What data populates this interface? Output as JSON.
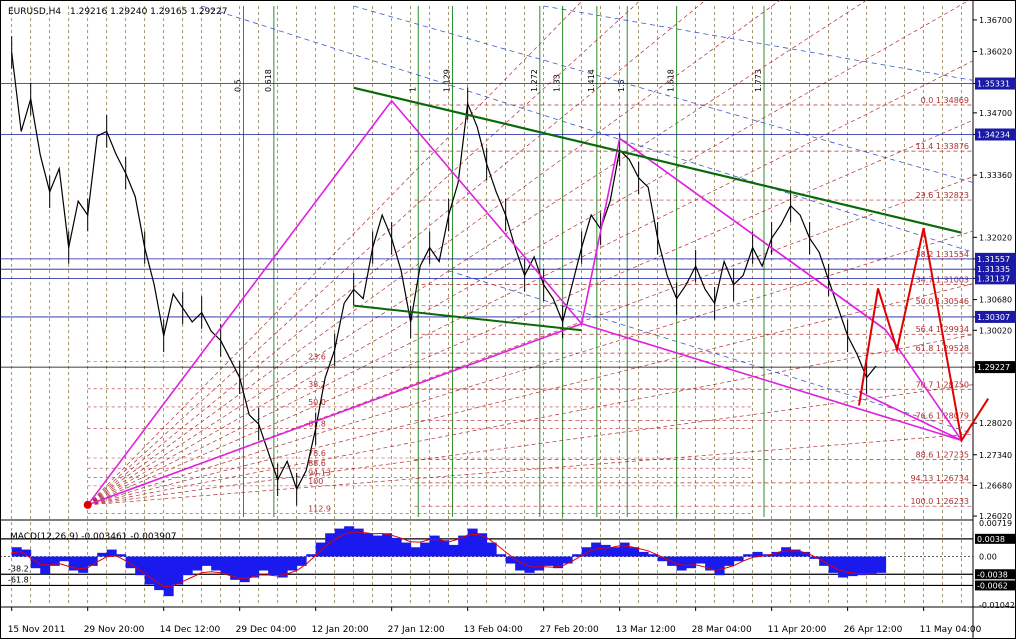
{
  "chart_data": {
    "type": "line",
    "symbol": "EURUSD,H4",
    "ohlc_header": "1.29216 1.29240 1.29165 1.29227",
    "price_axis": {
      "ylim": [
        1.26,
        1.37
      ],
      "ticks": [
        "1.36700",
        "1.36020",
        "1.35331",
        "1.34700",
        "1.34234",
        "1.33360",
        "1.32020",
        "1.31557",
        "1.31335",
        "1.31137",
        "1.30680",
        "1.30307",
        "1.30020",
        "1.29227",
        "1.28020",
        "1.27340",
        "1.26680",
        "1.26020"
      ],
      "highlighted": [
        {
          "label": "1.35331",
          "color": "#1a1aa6"
        },
        {
          "label": "1.34234",
          "color": "#1a1aa6"
        },
        {
          "label": "1.31557",
          "color": "#1a1aa6"
        },
        {
          "label": "1.31335",
          "color": "#1a1aa6"
        },
        {
          "label": "1.31137",
          "color": "#1a1aa6"
        },
        {
          "label": "1.30307",
          "color": "#1a1aa6"
        },
        {
          "label": "1.29227",
          "color": "#000000"
        }
      ]
    },
    "time_axis": {
      "labels": [
        "15 Nov 2011",
        "29 Nov 20:00",
        "14 Dec 12:00",
        "29 Dec 04:00",
        "12 Jan 20:00",
        "27 Jan 12:00",
        "13 Feb 04:00",
        "27 Feb 20:00",
        "13 Mar 12:00",
        "28 Mar 04:00",
        "11 Apr 20:00",
        "26 Apr 12:00",
        "11 May 04:00"
      ]
    },
    "fib_time_labels": [
      "0.5",
      "0.618",
      "1",
      "1.129",
      "1.272",
      "1.33",
      "1.414",
      "1.5",
      "1.618",
      "1.773"
    ],
    "fib_price_right": [
      {
        "label": "0.0  1.34869",
        "price": 1.34869
      },
      {
        "label": "11.4  1.33876",
        "price": 1.33876
      },
      {
        "label": "23.6  1.32823",
        "price": 1.32823
      },
      {
        "label": "38.2  1.31554",
        "price": 1.31554
      },
      {
        "label": "34.7  1.31003",
        "price": 1.31003
      },
      {
        "label": "50.0  1.30546",
        "price": 1.30546
      },
      {
        "label": "56.4  1.29934",
        "price": 1.29934
      },
      {
        "label": "61.8  1.29528",
        "price": 1.29528
      },
      {
        "label": "70.7  1.28750",
        "price": 1.2875
      },
      {
        "label": "76.6  1.28079",
        "price": 1.28079
      },
      {
        "label": "88.6  1.27235",
        "price": 1.27235
      },
      {
        "label": "94.13  1.26734",
        "price": 1.26734
      },
      {
        "label": "100.0  1.26233",
        "price": 1.26233
      }
    ],
    "fib_price_left": [
      {
        "label": "23.6",
        "price": 1.2935
      },
      {
        "label": "38.2",
        "price": 1.2876
      },
      {
        "label": "50.0",
        "price": 1.2837
      },
      {
        "label": "61.8",
        "price": 1.2791
      },
      {
        "label": "78.6",
        "price": 1.2727
      },
      {
        "label": "88.6",
        "price": 1.2705
      },
      {
        "label": "94.13",
        "price": 1.2685
      },
      {
        "label": "100",
        "price": 1.2667
      },
      {
        "label": "112.9",
        "price": 1.2608
      }
    ],
    "harmonic_pattern": [
      [
        2,
        1.2626
      ],
      [
        10,
        1.3496
      ],
      [
        15,
        1.3016
      ],
      [
        16,
        1.3415
      ],
      [
        23,
        1.3003
      ],
      [
        25,
        1.2765
      ]
    ],
    "pattern_ab_leg": [
      [
        10,
        1.3496
      ],
      [
        15,
        1.3016
      ]
    ],
    "channel_upper": [
      [
        9,
        1.3524
      ],
      [
        25,
        1.3212
      ]
    ],
    "channel_lower": [
      [
        9,
        1.3055
      ],
      [
        15,
        1.3002
      ]
    ],
    "projection": [
      [
        22.3,
        1.284
      ],
      [
        22.8,
        1.3092
      ],
      [
        23.3,
        1.296
      ],
      [
        24.0,
        1.3222
      ],
      [
        25,
        1.2765
      ],
      [
        25.7,
        1.2855
      ]
    ],
    "price_series": [
      [
        0.0,
        1.36
      ],
      [
        0.25,
        1.343
      ],
      [
        0.5,
        1.35
      ],
      [
        0.75,
        1.338
      ],
      [
        1.0,
        1.33
      ],
      [
        1.25,
        1.335
      ],
      [
        1.5,
        1.318
      ],
      [
        1.75,
        1.328
      ],
      [
        2.0,
        1.325
      ],
      [
        2.25,
        1.342
      ],
      [
        2.5,
        1.343
      ],
      [
        2.75,
        1.338
      ],
      [
        3.0,
        1.334
      ],
      [
        3.25,
        1.329
      ],
      [
        3.5,
        1.318
      ],
      [
        3.75,
        1.31
      ],
      [
        4.0,
        1.299
      ],
      [
        4.25,
        1.308
      ],
      [
        4.5,
        1.305
      ],
      [
        4.75,
        1.302
      ],
      [
        5.0,
        1.304
      ],
      [
        5.25,
        1.3
      ],
      [
        5.5,
        1.298
      ],
      [
        5.75,
        1.294
      ],
      [
        6.0,
        1.29
      ],
      [
        6.25,
        1.282
      ],
      [
        6.5,
        1.28
      ],
      [
        6.75,
        1.274
      ],
      [
        7.0,
        1.268
      ],
      [
        7.25,
        1.272
      ],
      [
        7.5,
        1.266
      ],
      [
        7.75,
        1.27
      ],
      [
        8.0,
        1.279
      ],
      [
        8.25,
        1.29
      ],
      [
        8.5,
        1.296
      ],
      [
        8.75,
        1.306
      ],
      [
        9.0,
        1.309
      ],
      [
        9.25,
        1.307
      ],
      [
        9.5,
        1.318
      ],
      [
        9.75,
        1.325
      ],
      [
        10.0,
        1.32
      ],
      [
        10.25,
        1.313
      ],
      [
        10.5,
        1.302
      ],
      [
        10.75,
        1.314
      ],
      [
        11.0,
        1.318
      ],
      [
        11.25,
        1.315
      ],
      [
        11.5,
        1.325
      ],
      [
        11.75,
        1.332
      ],
      [
        12.0,
        1.349
      ],
      [
        12.25,
        1.344
      ],
      [
        12.5,
        1.336
      ],
      [
        12.75,
        1.33
      ],
      [
        13.0,
        1.325
      ],
      [
        13.25,
        1.318
      ],
      [
        13.5,
        1.312
      ],
      [
        13.75,
        1.316
      ],
      [
        14.0,
        1.31
      ],
      [
        14.25,
        1.307
      ],
      [
        14.5,
        1.302
      ],
      [
        14.75,
        1.31
      ],
      [
        15.0,
        1.318
      ],
      [
        15.25,
        1.325
      ],
      [
        15.5,
        1.322
      ],
      [
        15.75,
        1.328
      ],
      [
        16.0,
        1.339
      ],
      [
        16.25,
        1.337
      ],
      [
        16.5,
        1.333
      ],
      [
        16.75,
        1.331
      ],
      [
        17.0,
        1.32
      ],
      [
        17.25,
        1.312
      ],
      [
        17.5,
        1.307
      ],
      [
        17.75,
        1.31
      ],
      [
        18.0,
        1.314
      ],
      [
        18.25,
        1.309
      ],
      [
        18.5,
        1.306
      ],
      [
        18.75,
        1.315
      ],
      [
        19.0,
        1.31
      ],
      [
        19.25,
        1.312
      ],
      [
        19.5,
        1.318
      ],
      [
        19.75,
        1.314
      ],
      [
        20.0,
        1.32
      ],
      [
        20.25,
        1.323
      ],
      [
        20.5,
        1.327
      ],
      [
        20.75,
        1.325
      ],
      [
        21.0,
        1.32
      ],
      [
        21.25,
        1.317
      ],
      [
        21.5,
        1.311
      ],
      [
        21.75,
        1.305
      ],
      [
        22.0,
        1.299
      ],
      [
        22.25,
        1.295
      ],
      [
        22.5,
        1.29
      ],
      [
        22.75,
        1.2925
      ]
    ],
    "macd": {
      "label": "MACD(12,26,9) -0.003461 -0.003907",
      "ylim": [
        -0.0104,
        0.0072
      ],
      "ticks": [
        "0.00719",
        "0.0038",
        "0.00",
        "-0.0038",
        "-0.0062",
        "-0.01042"
      ],
      "levels_left": [
        "-38.2",
        "-61.8"
      ],
      "histogram": [
        [
          0.0,
          0.002
        ],
        [
          0.25,
          0.0015
        ],
        [
          0.5,
          -0.0025
        ],
        [
          0.75,
          -0.0038
        ],
        [
          1.0,
          -0.002
        ],
        [
          1.25,
          -0.001
        ],
        [
          1.5,
          -0.003
        ],
        [
          1.75,
          -0.0035
        ],
        [
          2.0,
          -0.002
        ],
        [
          2.25,
          0.0008
        ],
        [
          2.5,
          0.0015
        ],
        [
          2.75,
          0.0005
        ],
        [
          3.0,
          -0.0025
        ],
        [
          3.25,
          -0.004
        ],
        [
          3.5,
          -0.006
        ],
        [
          3.75,
          -0.0072
        ],
        [
          4.0,
          -0.0085
        ],
        [
          4.25,
          -0.006
        ],
        [
          4.5,
          -0.004
        ],
        [
          4.75,
          -0.003
        ],
        [
          5.0,
          -0.002
        ],
        [
          5.25,
          -0.003
        ],
        [
          5.5,
          -0.0038
        ],
        [
          5.75,
          -0.005
        ],
        [
          6.0,
          -0.0055
        ],
        [
          6.25,
          -0.0045
        ],
        [
          6.5,
          -0.003
        ],
        [
          6.75,
          -0.004
        ],
        [
          7.0,
          -0.0045
        ],
        [
          7.25,
          -0.003
        ],
        [
          7.5,
          -0.002
        ],
        [
          7.75,
          0.0005
        ],
        [
          8.0,
          0.003
        ],
        [
          8.25,
          0.005
        ],
        [
          8.5,
          0.006
        ],
        [
          8.75,
          0.0065
        ],
        [
          9.0,
          0.006
        ],
        [
          9.25,
          0.005
        ],
        [
          9.5,
          0.0045
        ],
        [
          9.75,
          0.005
        ],
        [
          10.0,
          0.004
        ],
        [
          10.25,
          0.003
        ],
        [
          10.5,
          0.002
        ],
        [
          10.75,
          0.003
        ],
        [
          11.0,
          0.0045
        ],
        [
          11.25,
          0.0035
        ],
        [
          11.5,
          0.0025
        ],
        [
          11.75,
          0.0045
        ],
        [
          12.0,
          0.006
        ],
        [
          12.25,
          0.005
        ],
        [
          12.5,
          0.003
        ],
        [
          12.75,
          0.0005
        ],
        [
          13.0,
          -0.0015
        ],
        [
          13.25,
          -0.003
        ],
        [
          13.5,
          -0.0035
        ],
        [
          13.75,
          -0.003
        ],
        [
          14.0,
          -0.002
        ],
        [
          14.25,
          -0.0025
        ],
        [
          14.5,
          -0.0015
        ],
        [
          14.75,
          0.0005
        ],
        [
          15.0,
          0.002
        ],
        [
          15.25,
          0.003
        ],
        [
          15.5,
          0.0025
        ],
        [
          15.75,
          0.002
        ],
        [
          16.0,
          0.003
        ],
        [
          16.25,
          0.002
        ],
        [
          16.5,
          0.001
        ],
        [
          16.75,
          0.0005
        ],
        [
          17.0,
          -0.001
        ],
        [
          17.25,
          -0.002
        ],
        [
          17.5,
          -0.003
        ],
        [
          17.75,
          -0.0025
        ],
        [
          18.0,
          -0.0015
        ],
        [
          18.25,
          -0.003
        ],
        [
          18.5,
          -0.004
        ],
        [
          18.75,
          -0.002
        ],
        [
          19.0,
          -0.001
        ],
        [
          19.25,
          0.0005
        ],
        [
          19.5,
          0.001
        ],
        [
          19.75,
          0.0005
        ],
        [
          20.0,
          0.001
        ],
        [
          20.25,
          0.002
        ],
        [
          20.5,
          0.0015
        ],
        [
          20.75,
          0.001
        ],
        [
          21.0,
          -0.0005
        ],
        [
          21.25,
          -0.002
        ],
        [
          21.5,
          -0.0035
        ],
        [
          21.75,
          -0.0045
        ],
        [
          22.0,
          -0.0042
        ],
        [
          22.25,
          -0.004
        ],
        [
          22.5,
          -0.0038
        ],
        [
          22.75,
          -0.0035
        ]
      ]
    }
  },
  "colors": {
    "background": "#ffffff",
    "price_line": "#000000",
    "pattern": "#e020e0",
    "channel": "#0a6a0a",
    "projection": "#e00000",
    "fib_price": "#b03030",
    "fib_time": "#2e8b2e",
    "hline": "#1a1aa6",
    "macd_hist": "#1a1aee",
    "macd_signal": "#e00000",
    "grid": "#7a6a3a"
  }
}
